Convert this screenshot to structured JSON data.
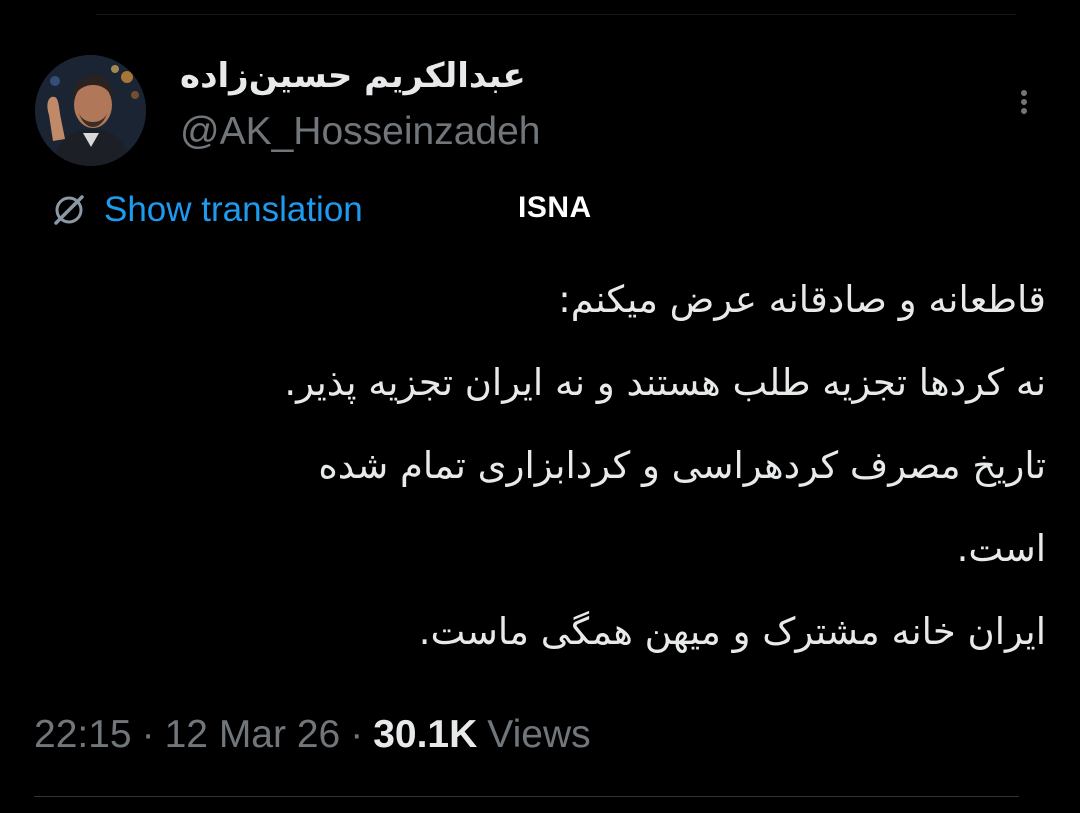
{
  "author": {
    "display_name": "عبدالکریم حسین‌زاده",
    "handle": "@AK_Hosseinzadeh"
  },
  "more_menu": {
    "icon": "more-vertical-icon"
  },
  "translation": {
    "label": "Show translation",
    "icon": "globe-translate-icon",
    "accent_color": "#1d9bf0"
  },
  "watermark": "ISNA",
  "tweet": {
    "lines": [
      "قاطعانه و صادقانه عرض میکنم:",
      "نه کردها تجزیه طلب هستند و نه ایران تجزیه پذیر.",
      "تاریخ مصرف کردهراسی و کردابزاری تمام شده",
      "است.",
      "ایران خانه مشترک و میهن همگی ماست."
    ]
  },
  "meta": {
    "time": "22:15",
    "separator": "·",
    "date": "12 Mar 26",
    "views_count": "30.1K",
    "views_label": "Views"
  },
  "colors": {
    "background": "#000000",
    "text_primary": "#e7e9ea",
    "text_secondary": "#71767b",
    "divider": "#2f3336"
  }
}
